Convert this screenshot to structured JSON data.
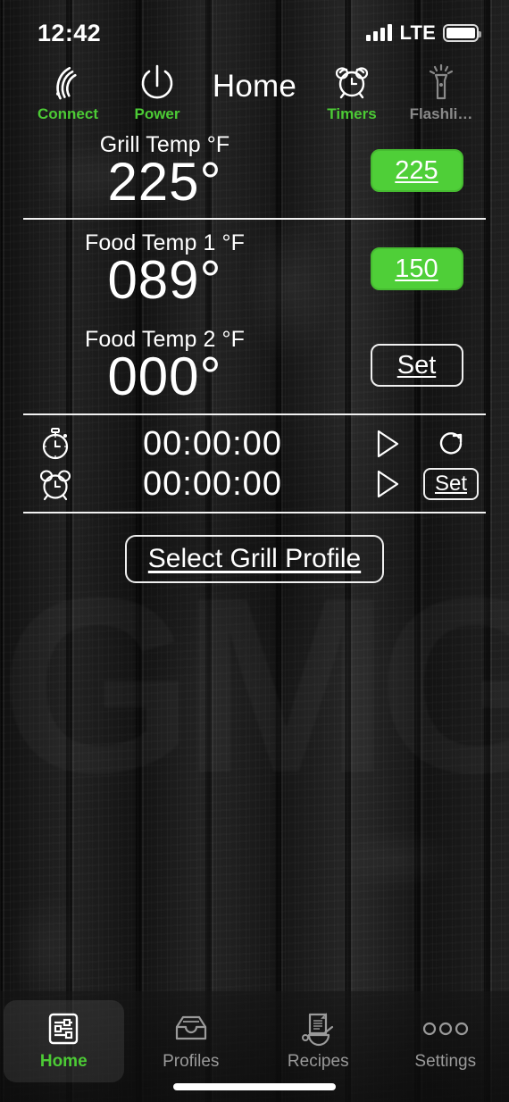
{
  "status_bar": {
    "time": "12:42",
    "network_label": "LTE",
    "signal_icon": "signal-bars-icon",
    "battery_icon": "battery-full-icon"
  },
  "toolbar": {
    "title": "Home",
    "items": [
      {
        "label": "Connect",
        "icon": "wifi-icon",
        "state": "active"
      },
      {
        "label": "Power",
        "icon": "power-icon",
        "state": "active"
      },
      {
        "label": "Timers",
        "icon": "alarm-clock-icon",
        "state": "active"
      },
      {
        "label": "Flashli…",
        "icon": "flashlight-icon",
        "state": "dim"
      }
    ]
  },
  "temps": [
    {
      "label": "Grill Temp °F",
      "value": "225°",
      "target_label": "225",
      "target_style": "green"
    },
    {
      "label": "Food Temp 1 °F",
      "value": "089°",
      "target_label": "150",
      "target_style": "green"
    },
    {
      "label": "Food Temp 2 °F",
      "value": "000°",
      "target_label": "Set",
      "target_style": "outline"
    }
  ],
  "timers": [
    {
      "icon": "stopwatch-icon",
      "time": "00:00:00",
      "play": "play-icon",
      "action_icon": "reset-icon",
      "action_label": ""
    },
    {
      "icon": "alarm-clock-icon",
      "time": "00:00:00",
      "play": "play-icon",
      "action_icon": "",
      "action_label": "Set"
    }
  ],
  "profile_button": {
    "label": "Select Grill Profile"
  },
  "watermark": {
    "text": "GMG"
  },
  "tabbar": {
    "items": [
      {
        "label": "Home",
        "icon": "sliders-icon",
        "active": true
      },
      {
        "label": "Profiles",
        "icon": "tray-icon",
        "active": false
      },
      {
        "label": "Recipes",
        "icon": "recipe-icon",
        "active": false
      },
      {
        "label": "Settings",
        "icon": "ellipsis-icon",
        "active": false
      }
    ]
  },
  "colors": {
    "accent_green": "#4fcf38",
    "label_green": "#4ccb35",
    "text": "#ffffff",
    "dim": "#9a9a9a"
  }
}
